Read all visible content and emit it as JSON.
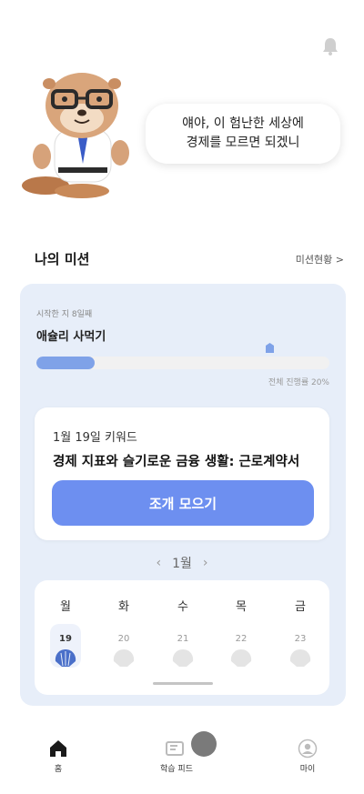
{
  "header": {
    "bell_icon": "bell-icon"
  },
  "character": {
    "speech_line1": "얘야, 이 험난한 세상에",
    "speech_line2": "경제를 모르면 되겠니"
  },
  "mission": {
    "title": "나의 미션",
    "status_link": "미션현황 >",
    "days_since_start": "시작한 지 8일째",
    "goal": "애슐리 사먹기",
    "progress_label": "전체 진행률 20%",
    "progress_fraction": 0.2
  },
  "keyword": {
    "date": "1월 19일 키워드",
    "title": "경제 지표와 슬기로운 금융 생활: 근로계약서",
    "button": "조개 모으기"
  },
  "calendar": {
    "prev": "‹",
    "month": "1월",
    "next": "›",
    "days": [
      {
        "name": "월",
        "date": "19",
        "active": true
      },
      {
        "name": "화",
        "date": "20",
        "active": false
      },
      {
        "name": "수",
        "date": "21",
        "active": false
      },
      {
        "name": "목",
        "date": "22",
        "active": false
      },
      {
        "name": "금",
        "date": "23",
        "active": false
      }
    ]
  },
  "tabs": [
    {
      "label": "홈",
      "icon": "home-icon"
    },
    {
      "label": "학습 피드",
      "icon": "feed-icon"
    },
    {
      "label": "마이",
      "icon": "profile-icon"
    }
  ],
  "colors": {
    "accent": "#6d8ff0",
    "card_bg": "#e7eef9",
    "progress": "#7fa2e8",
    "shell_active": "#4a6fc9",
    "shell_inactive": "#e4e4e4"
  }
}
